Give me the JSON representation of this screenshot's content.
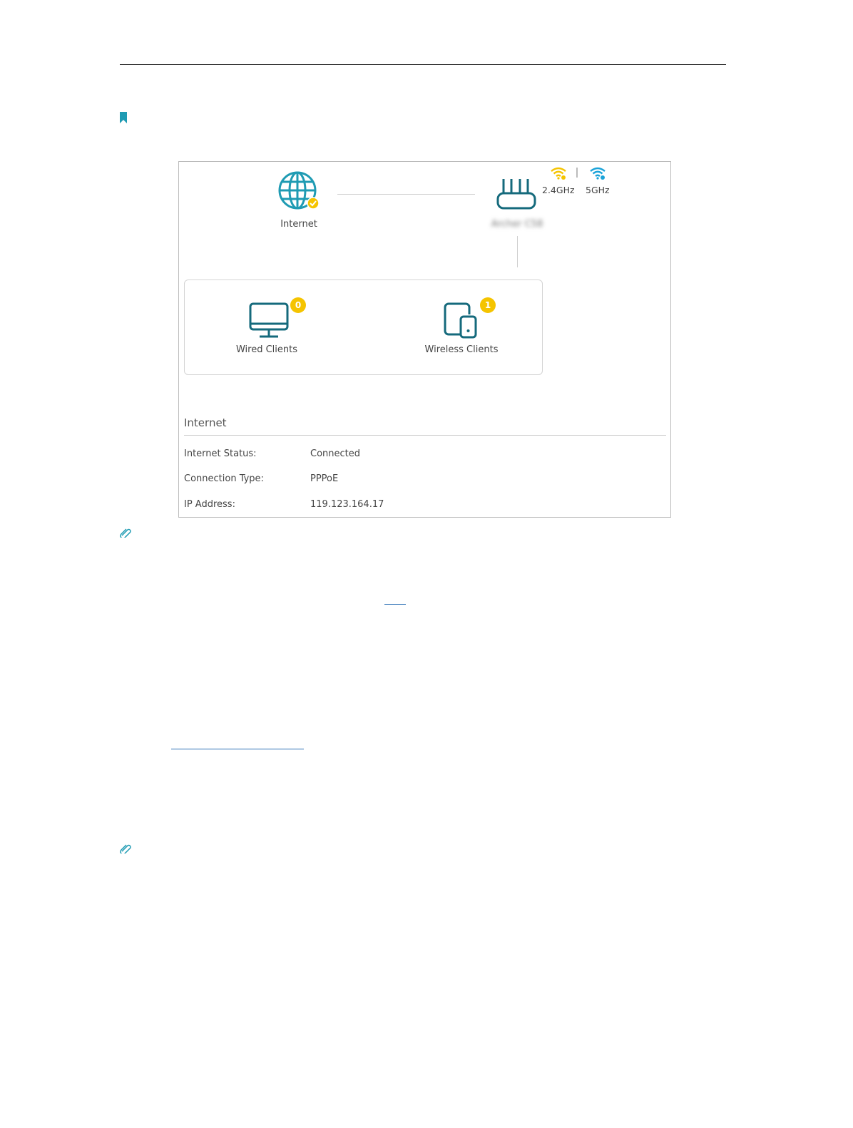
{
  "icons": {
    "bookmark": "bookmark-icon",
    "note": "paperclip-icon",
    "internet": "globe-icon",
    "router": "router-icon",
    "wired": "monitor-icon",
    "wireless": "tablet-phone-icon"
  },
  "colors": {
    "teal": "#1f9bb3",
    "dark_teal": "#156a7c",
    "yellow": "#f5c400",
    "blue": "#1aa3d9"
  },
  "network_map": {
    "internet_label": "Internet",
    "router_name": "Archer C58",
    "bands": [
      {
        "label": "2.4GHz"
      },
      {
        "label": "5GHz"
      }
    ],
    "wired_clients": {
      "label": "Wired Clients",
      "count": "0"
    },
    "wireless_clients": {
      "label": "Wireless Clients",
      "count": "1"
    }
  },
  "internet_section": {
    "title": "Internet",
    "rows": [
      {
        "label": "Internet Status:",
        "value": "Connected"
      },
      {
        "label": "Connection Type:",
        "value": "PPPoE"
      },
      {
        "label": "IP Address:",
        "value": "119.123.164.17"
      }
    ]
  }
}
